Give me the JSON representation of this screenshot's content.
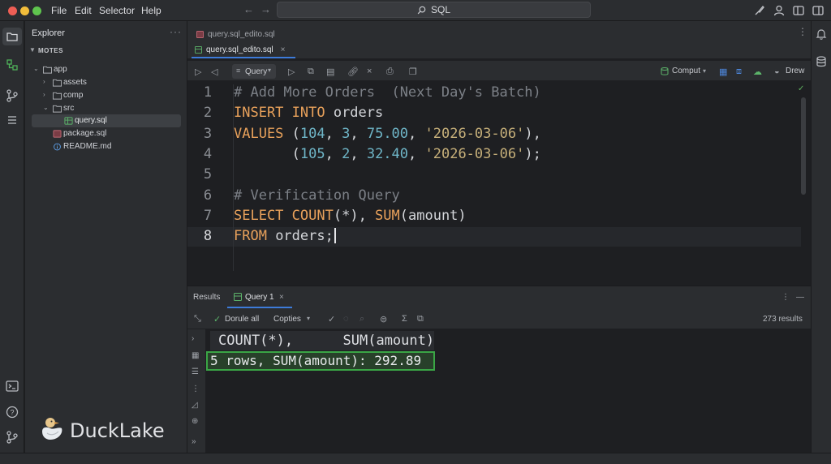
{
  "titlebar": {
    "menu": [
      "File",
      "Edit",
      "Selector",
      "Help"
    ],
    "search_text": "SQL"
  },
  "sidebar": {
    "title": "Explorer",
    "more": "···",
    "section": "MOTES",
    "tree": [
      {
        "label": "app",
        "type": "folder"
      },
      {
        "label": "assets",
        "type": "folder"
      },
      {
        "label": "comp",
        "type": "folder"
      },
      {
        "label": "src",
        "type": "folder"
      },
      {
        "label": "query.sql",
        "type": "sql-file"
      },
      {
        "label": "package.sql",
        "type": "sql-file"
      },
      {
        "label": "README.md",
        "type": "info-file"
      }
    ],
    "brand": "DuckLake"
  },
  "tabs": {
    "first": "query.sql_edito.sql",
    "active": "query.sql_edito.sql"
  },
  "editor_toolbar": {
    "query_label": "Query",
    "compute_label": "Comput",
    "user_label": "Drew"
  },
  "editor": {
    "line_numbers": [
      "1",
      "2",
      "3",
      "4",
      "5",
      "6",
      "7",
      "8"
    ],
    "line1": "# Add More Orders  (Next Day's Batch)",
    "line2_kw": "INSERT INTO",
    "line2_rest": " orders",
    "line3_kw": "VALUES",
    "line3_p1": " (",
    "line3_n1": "104",
    "line3_c1": ", ",
    "line3_n2": "3",
    "line3_c2": ", ",
    "line3_n3": "75.00",
    "line3_c3": ", ",
    "line3_s": "'2026-03-06'",
    "line3_end": "),",
    "line4_pad": "       (",
    "line4_n1": "105",
    "line4_c1": ", ",
    "line4_n2": "2",
    "line4_c2": ", ",
    "line4_n3": "32.40",
    "line4_c3": ", ",
    "line4_s": "'2026-03-06'",
    "line4_end": ");",
    "line6": "# Verification Query",
    "line7_kw1": "SELECT",
    "line7_sp": " ",
    "line7_fn1": "COUNT",
    "line7_a1": "(*), ",
    "line7_fn2": "SUM",
    "line7_a2": "(amount)",
    "line8_kw": "FROM",
    "line8_rest": " orders;"
  },
  "results": {
    "panel_title": "Results",
    "tab_label": "Query 1",
    "toolbar_double": "Dorule all",
    "toolbar_copies": "Copties",
    "count": "273 results",
    "header": "COUNT(*),      SUM(amount)",
    "row": "5 rows, SUM(amount): 292.89"
  },
  "colors": {
    "accent": "#3d7bd9",
    "keyword": "#e8a15b",
    "number": "#6fb6c8",
    "string": "#c7b07a",
    "comment": "#7c8087",
    "result_highlight": "#3aa545"
  }
}
